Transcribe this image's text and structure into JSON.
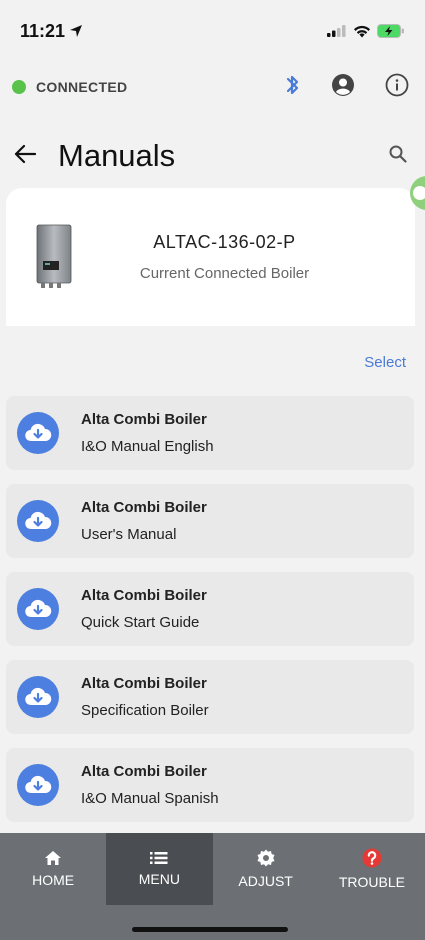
{
  "status": {
    "time": "11:21"
  },
  "connection": {
    "status": "CONNECTED"
  },
  "header": {
    "title": "Manuals"
  },
  "boiler": {
    "model": "ALTAC-136-02-P",
    "subtitle": "Current Connected Boiler"
  },
  "select_label": "Select",
  "manuals": [
    {
      "title": "Alta Combi Boiler",
      "name": "I&O Manual English"
    },
    {
      "title": "Alta Combi Boiler",
      "name": "User's Manual"
    },
    {
      "title": "Alta Combi Boiler",
      "name": "Quick Start Guide"
    },
    {
      "title": "Alta Combi Boiler",
      "name": "Specification Boiler"
    },
    {
      "title": "Alta Combi Boiler",
      "name": "I&O Manual Spanish"
    }
  ],
  "nav": [
    {
      "label": "HOME",
      "icon": "home-icon"
    },
    {
      "label": "MENU",
      "icon": "menu-icon",
      "active": true
    },
    {
      "label": "ADJUST",
      "icon": "gear-icon"
    },
    {
      "label": "TROUBLE",
      "icon": "help-icon"
    }
  ],
  "colors": {
    "connected": "#58c24a",
    "accent": "#4d7fe0",
    "bluetooth": "#4a7bd6",
    "trouble": "#e53935",
    "nav_bg": "#6c7074",
    "nav_active": "#4a4d51"
  }
}
